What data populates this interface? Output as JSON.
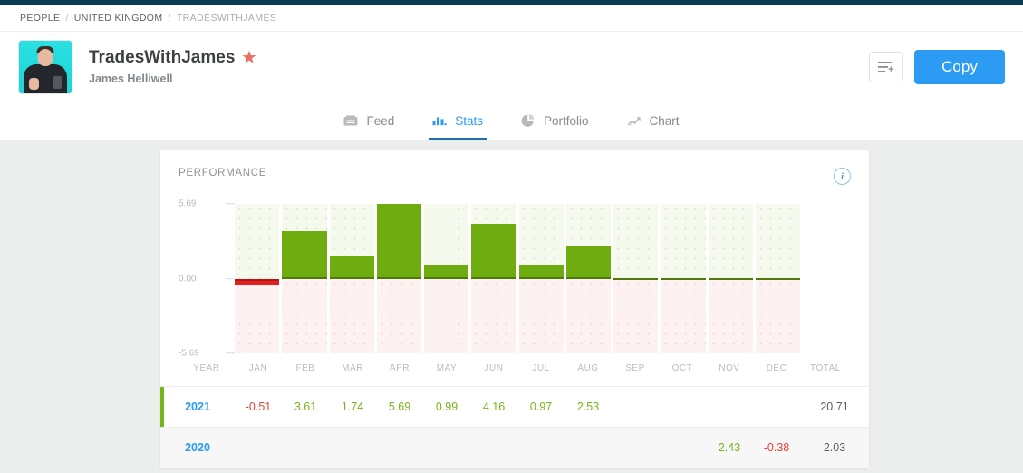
{
  "breadcrumb": {
    "items": [
      "PEOPLE",
      "UNITED KINGDOM",
      "TRADESWITHJAMES"
    ],
    "separator": "/"
  },
  "profile": {
    "username": "TradesWithJames",
    "realname": "James Helliwell",
    "star_icon": "star-icon",
    "avatar_alt": "avatar"
  },
  "actions": {
    "list_icon": "add-to-list-icon",
    "copy_label": "Copy",
    "copy_color": "#2b9bf4"
  },
  "tabs": [
    {
      "label": "Feed",
      "icon": "feed-icon",
      "active": false
    },
    {
      "label": "Stats",
      "icon": "bar-chart-icon",
      "active": true
    },
    {
      "label": "Portfolio",
      "icon": "pie-chart-icon",
      "active": false
    },
    {
      "label": "Chart",
      "icon": "trend-up-icon",
      "active": false
    }
  ],
  "performance": {
    "title": "PERFORMANCE",
    "info_icon": "info-icon"
  },
  "chart_data": {
    "type": "bar",
    "title": "PERFORMANCE",
    "categories": [
      "JAN",
      "FEB",
      "MAR",
      "APR",
      "MAY",
      "JUN",
      "JUL",
      "AUG",
      "SEP",
      "OCT",
      "NOV",
      "DEC"
    ],
    "values": [
      -0.51,
      3.61,
      1.74,
      5.69,
      0.99,
      4.16,
      0.97,
      2.53,
      null,
      null,
      null,
      null
    ],
    "ylim": [
      -5.69,
      5.69
    ],
    "yticks": [
      "5.69",
      "0.00",
      "-5.69"
    ],
    "ylabel": "",
    "xlabel": "",
    "grid": false,
    "legend": false,
    "positive_color": "#6fac10",
    "negative_color": "#e01f1f"
  },
  "table": {
    "headers": [
      "YEAR",
      "JAN",
      "FEB",
      "MAR",
      "APR",
      "MAY",
      "JUN",
      "JUL",
      "AUG",
      "SEP",
      "OCT",
      "NOV",
      "DEC",
      "TOTAL"
    ],
    "rows": [
      {
        "year": "2021",
        "months": [
          "-0.51",
          "3.61",
          "1.74",
          "5.69",
          "0.99",
          "4.16",
          "0.97",
          "2.53",
          "",
          "",
          "",
          ""
        ],
        "signs": [
          "neg",
          "pos",
          "pos",
          "pos",
          "pos",
          "pos",
          "pos",
          "pos",
          "",
          "",
          "",
          ""
        ],
        "total": "20.71",
        "highlighted": true
      },
      {
        "year": "2020",
        "months": [
          "",
          "",
          "",
          "",
          "",
          "",
          "",
          "",
          "",
          "",
          "2.43",
          "-0.38"
        ],
        "signs": [
          "",
          "",
          "",
          "",
          "",
          "",
          "",
          "",
          "",
          "",
          "pos",
          "neg"
        ],
        "total": "2.03",
        "highlighted": false
      }
    ]
  }
}
